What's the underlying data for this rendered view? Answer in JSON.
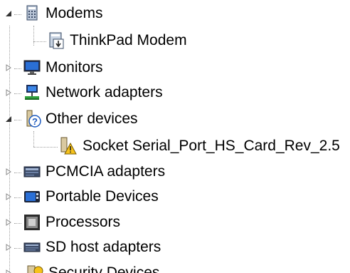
{
  "tree": {
    "items": [
      {
        "label": "Modems",
        "expanded": true,
        "icon": "modem-icon"
      },
      {
        "label": "ThinkPad Modem",
        "icon": "modem-device-icon"
      },
      {
        "label": "Monitors",
        "expanded": false,
        "icon": "monitor-icon"
      },
      {
        "label": "Network adapters",
        "expanded": false,
        "icon": "network-adapter-icon"
      },
      {
        "label": "Other devices",
        "expanded": true,
        "icon": "unknown-device-icon"
      },
      {
        "label": "Socket Serial_Port_HS_Card_Rev_2.5",
        "icon": "warning-device-icon"
      },
      {
        "label": "PCMCIA adapters",
        "expanded": false,
        "icon": "pcmcia-icon"
      },
      {
        "label": "Portable Devices",
        "expanded": false,
        "icon": "portable-device-icon"
      },
      {
        "label": "Processors",
        "expanded": false,
        "icon": "processor-icon"
      },
      {
        "label": "SD host adapters",
        "expanded": false,
        "icon": "sd-host-icon"
      },
      {
        "label": "Security Devices",
        "expanded": false,
        "icon": "security-device-icon"
      }
    ]
  }
}
